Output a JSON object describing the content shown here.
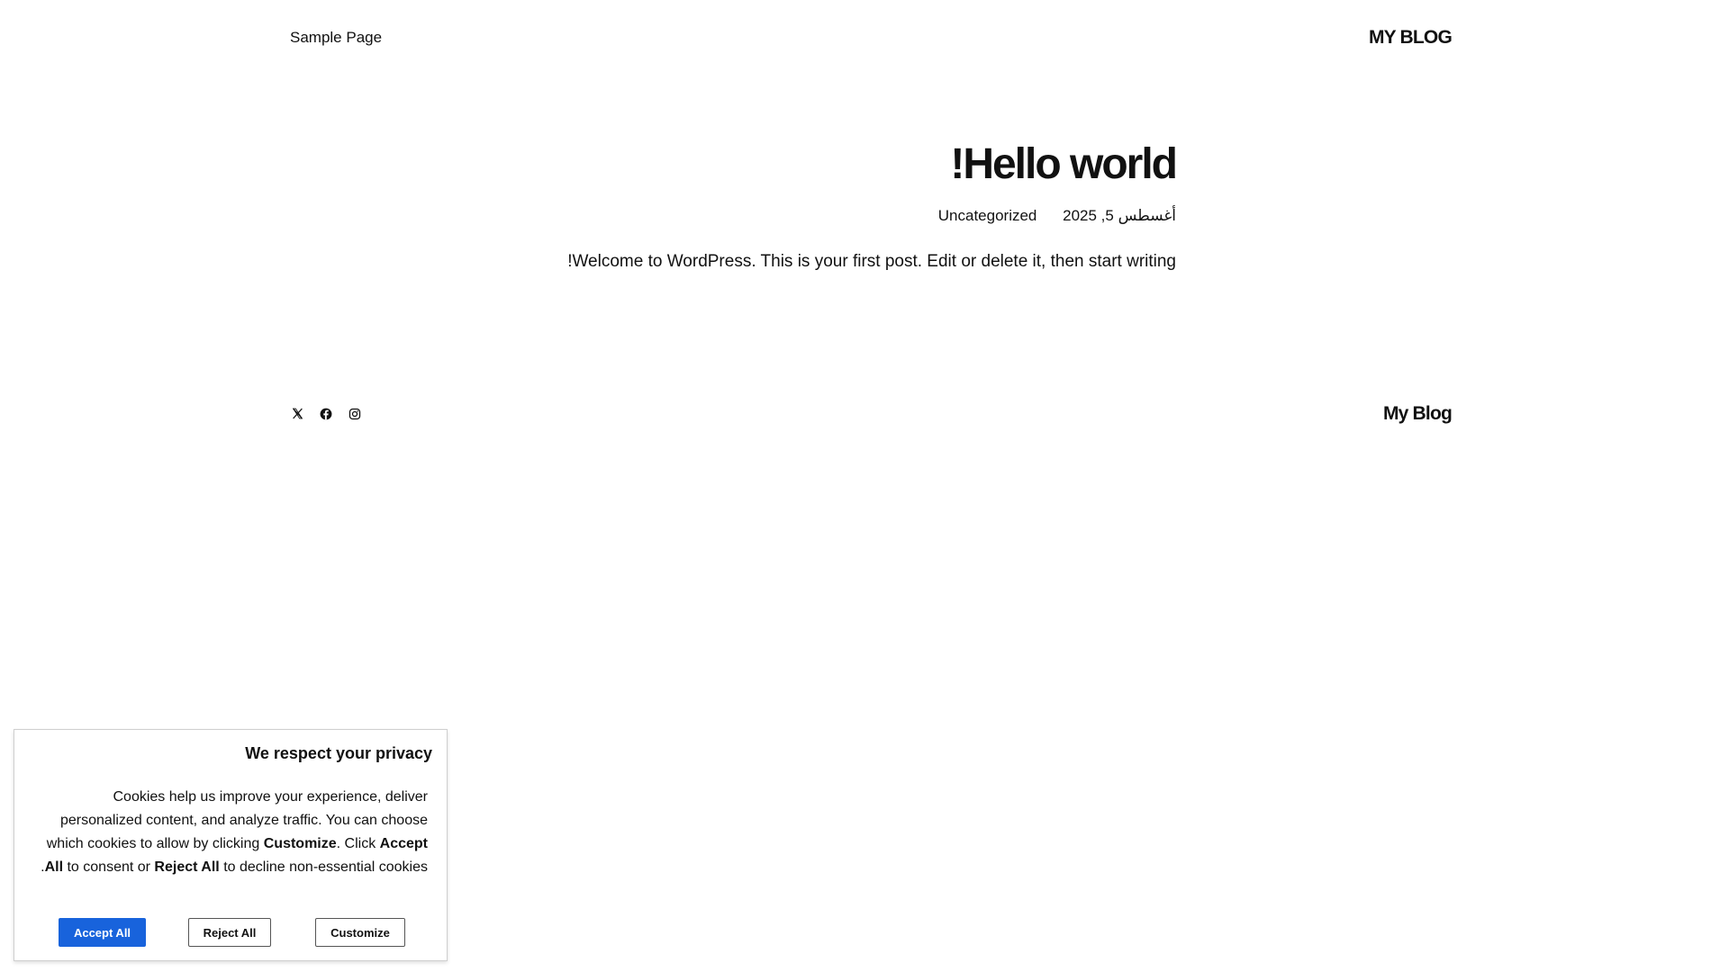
{
  "header": {
    "nav_label": "Sample Page",
    "site_title": "MY BLOG"
  },
  "post": {
    "title": "Hello world!",
    "date": "أغسطس 5, 2025",
    "category": "Uncategorized",
    "content": "Welcome to WordPress. This is your first post. Edit or delete it, then start writing!"
  },
  "footer": {
    "social_icons": [
      "x-icon",
      "facebook-icon",
      "instagram-icon"
    ],
    "site_title": "My Blog"
  },
  "cookie_banner": {
    "title": "We respect your privacy",
    "text_part1": "Cookies help us improve your experience, deliver personalized content, and analyze traffic. You can choose which cookies to allow by clicking ",
    "text_customize": "Customize",
    "text_part2": ". Click ",
    "text_accept": "Accept All",
    "text_part3": " to consent or ",
    "text_reject": "Reject All",
    "text_part4": " to decline non-essential cookies.",
    "accept_label": "Accept All",
    "reject_label": "Reject All",
    "customize_label": "Customize",
    "accent_color": "#1863dc"
  }
}
